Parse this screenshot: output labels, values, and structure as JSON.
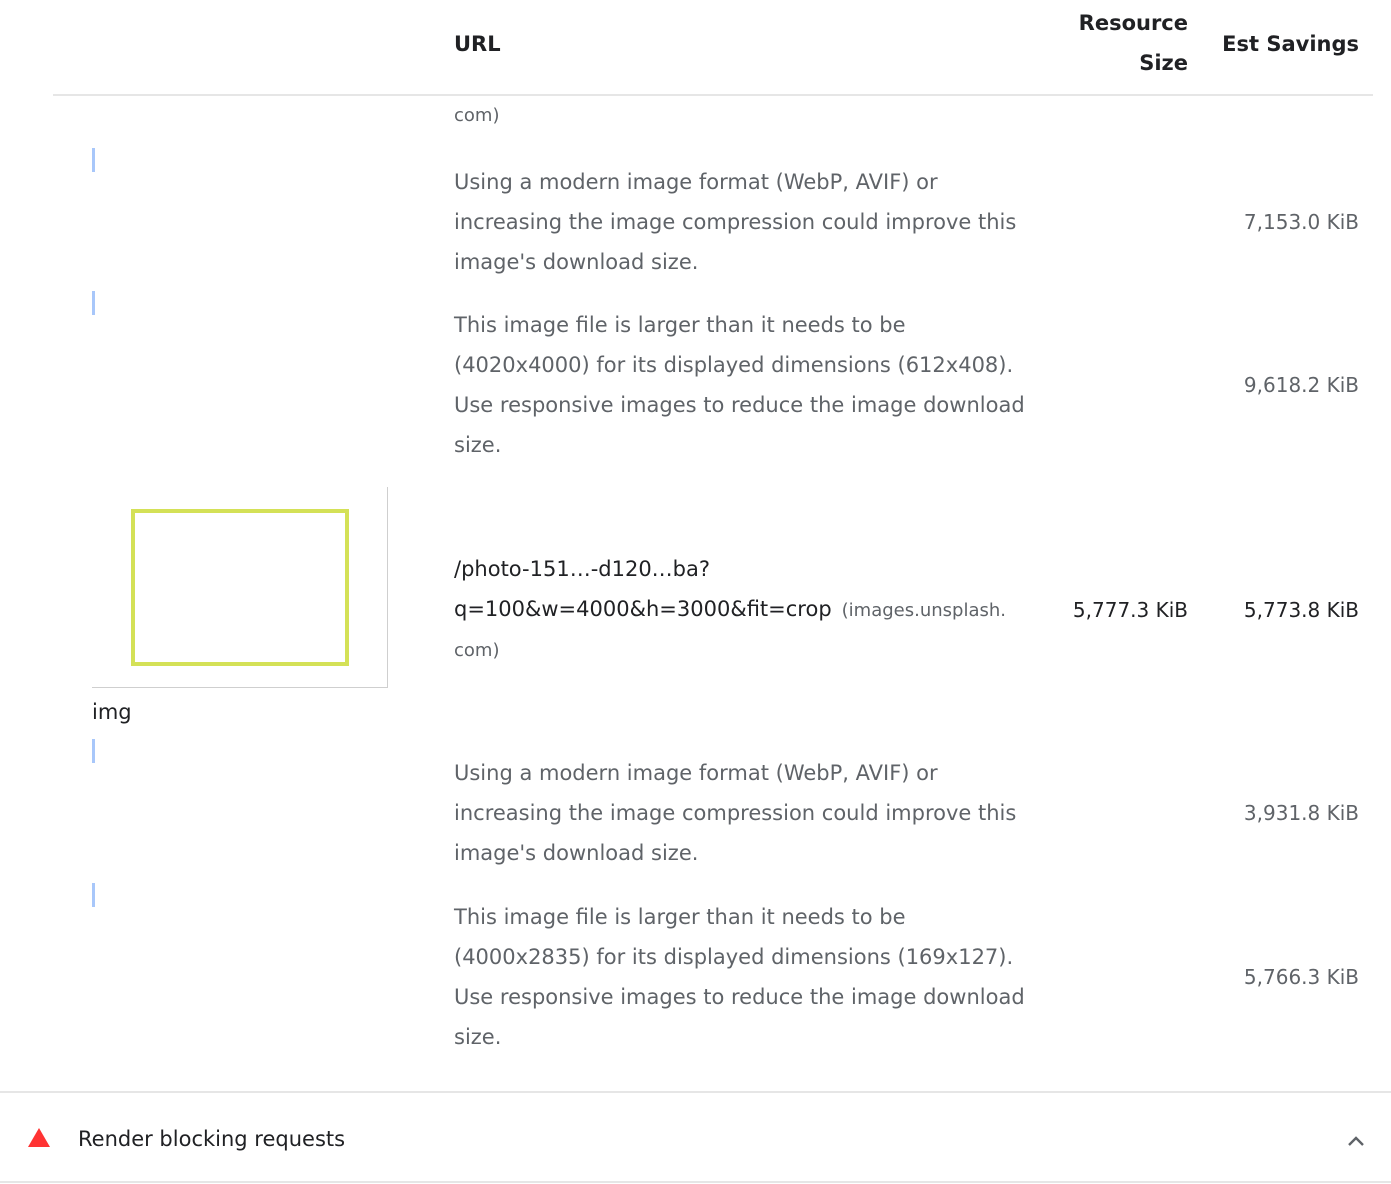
{
  "table": {
    "headers": {
      "url": "URL",
      "resource_size_line1": "Resource",
      "resource_size_line2": "Size",
      "est_savings": "Est Savings"
    },
    "prev_item_tail": "com)",
    "prev_item_subitems": [
      {
        "description": "Using a modern image format (WebP, AVIF) or increasing the image compression could improve this image's download size.",
        "savings": "7,153.0 KiB"
      },
      {
        "description": "This image file is larger than it needs to be (4020x4000) for its displayed dimensions (612x408). Use responsive images to reduce the image download size.",
        "savings": "9,618.2 KiB"
      }
    ],
    "item": {
      "element_label": "img",
      "url_line1": "/photo-151…-d120…ba?",
      "url_line2": "q=100&w=4000&h=3000&fit=crop",
      "host_part1": "(images.unsplash.",
      "host_part2": "com)",
      "resource_size": "5,777.3 KiB",
      "est_savings": "5,773.8 KiB",
      "subitems": [
        {
          "description": "Using a modern image format (WebP, AVIF) or increasing the image compression could improve this image's download size.",
          "savings": "3,931.8 KiB"
        },
        {
          "description": "This image file is larger than it needs to be (4000x2835) for its displayed dimensions (169x127). Use responsive images to reduce the image download size.",
          "savings": "5,766.3 KiB"
        }
      ]
    }
  },
  "next_audit": {
    "title": "Render blocking requests",
    "status": "fail",
    "icon": "red-triangle-warning-icon",
    "toggle_icon": "chevron-up-icon"
  },
  "colors": {
    "fail": "#ff3333",
    "marker": "#a8c7fa",
    "thumb_border": "#d4e157"
  }
}
